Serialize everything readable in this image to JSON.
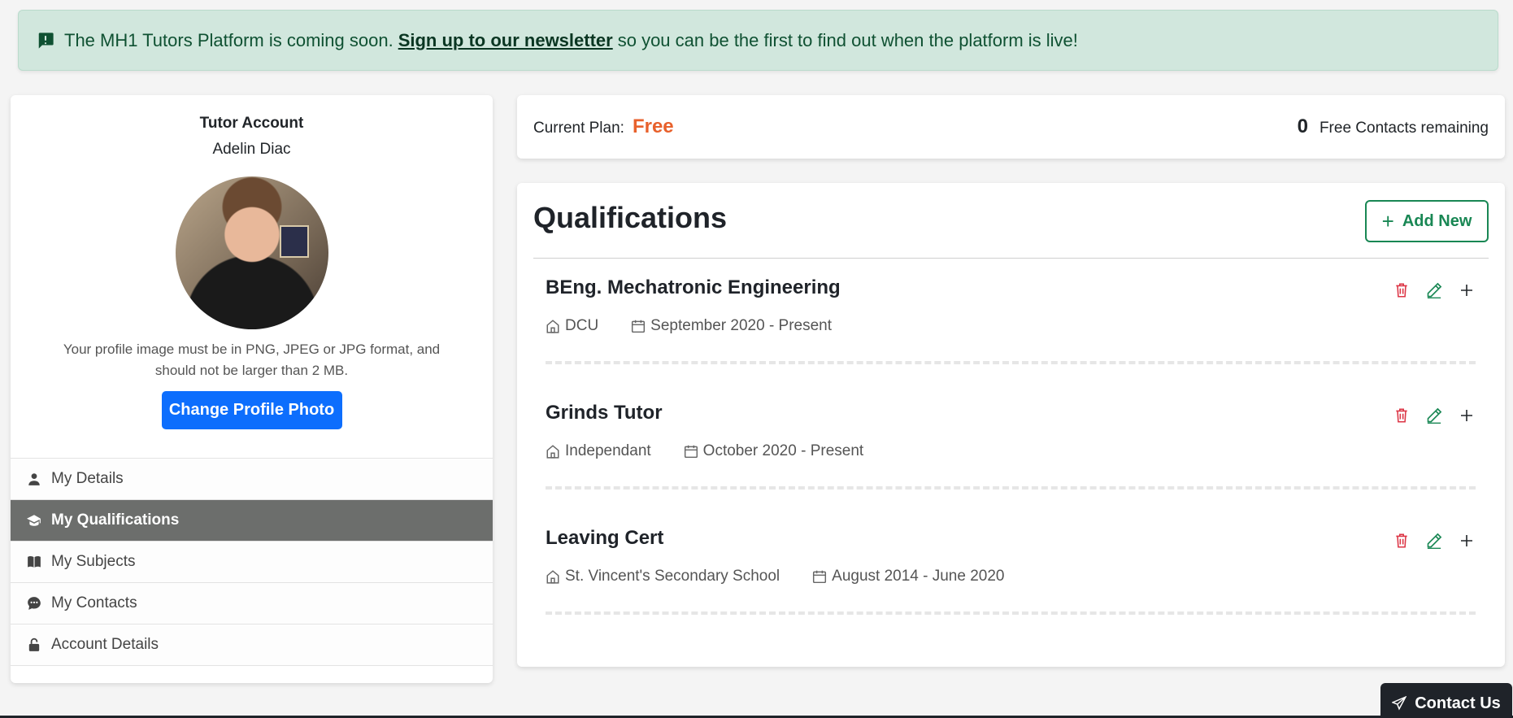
{
  "banner": {
    "icon": "alert-message-icon",
    "text_before": "The MH1 Tutors Platform is coming soon.",
    "link": "Sign up to our newsletter",
    "text_after": "so you can be the first to find out when the platform is live!"
  },
  "sidebar": {
    "account_type": "Tutor Account",
    "name": "Adelin Diac",
    "photo_note": "Your profile image must be in PNG, JPEG or JPG format, and should not be larger than 2 MB.",
    "change_photo_label": "Change Profile Photo",
    "menu": [
      {
        "label": "My Details",
        "icon": "person-icon",
        "active": false
      },
      {
        "label": "My Qualifications",
        "icon": "graduation-cap-icon",
        "active": true
      },
      {
        "label": "My Subjects",
        "icon": "book-icon",
        "active": false
      },
      {
        "label": "My Contacts",
        "icon": "chat-icon",
        "active": false
      },
      {
        "label": "Account Details",
        "icon": "lock-icon",
        "active": false
      }
    ]
  },
  "plan": {
    "label": "Current Plan:",
    "value": "Free",
    "contacts_count": "0",
    "contacts_label": "Free Contacts remaining"
  },
  "qualifications": {
    "title": "Qualifications",
    "add_label": "Add New",
    "items": [
      {
        "name": "BEng. Mechatronic Engineering",
        "institution": "DCU",
        "dates": "September 2020 - Present"
      },
      {
        "name": "Grinds Tutor",
        "institution": "Independant",
        "dates": "October 2020 - Present"
      },
      {
        "name": "Leaving Cert",
        "institution": "St. Vincent's Secondary School",
        "dates": "August 2014 - June 2020"
      }
    ]
  },
  "contact_button": "Contact Us",
  "colors": {
    "banner_bg": "#d1e7dd",
    "banner_text": "#0f5132",
    "primary": "#0d6efd",
    "plan_accent": "#e8612c",
    "success": "#198754",
    "danger": "#dc3545",
    "active_menu": "#6c6e6c"
  }
}
